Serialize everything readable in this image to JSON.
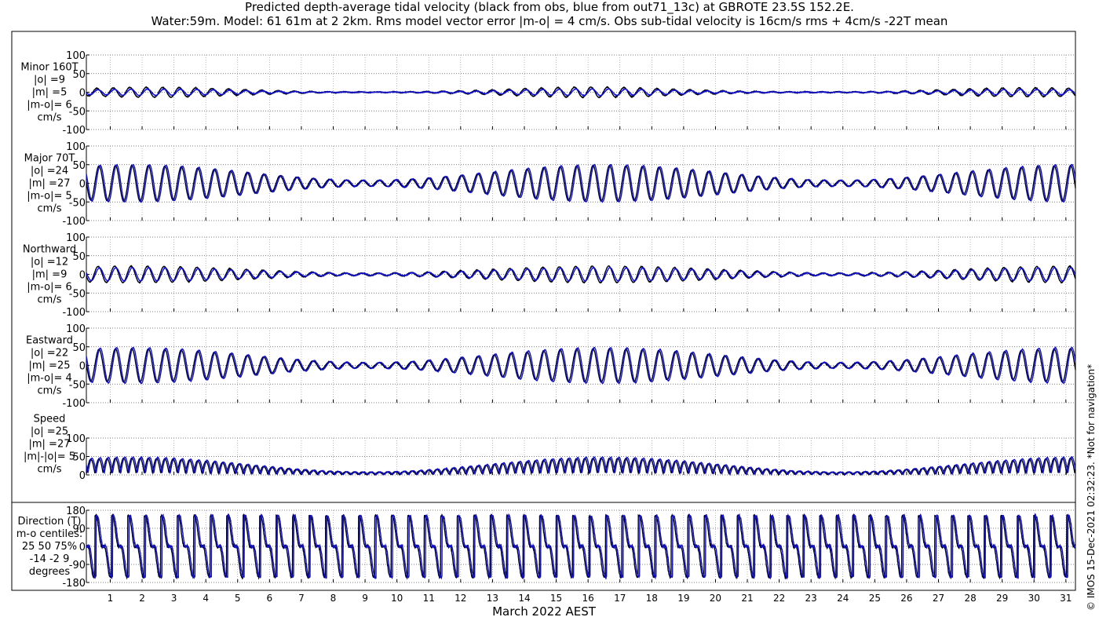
{
  "title": {
    "line1": "Predicted depth-average tidal velocity (black from obs, blue from out71_13c) at GBROTE 23.5S 152.2E.",
    "line2": "Water:59m. Model: 61 61m at 2 2km. Rms model vector error |m-o| = 4 cm/s. Obs sub-tidal velocity is 16cm/s rms + 4cm/s -22T mean"
  },
  "stamp": "© IMOS 15-Dec-2021 02:32:23. *Not for navigation*",
  "colors": {
    "obs": "#000000",
    "model": "#1111cc",
    "grid": "#555555"
  },
  "chart_data": {
    "type": "line",
    "xlabel": "March 2022 AEST",
    "x_ticks": [
      "1",
      "2",
      "3",
      "4",
      "5",
      "6",
      "7",
      "8",
      "9",
      "10",
      "11",
      "12",
      "13",
      "14",
      "15",
      "16",
      "17",
      "18",
      "19",
      "20",
      "21",
      "22",
      "23",
      "24",
      "25",
      "26",
      "27",
      "28",
      "29",
      "30",
      "31"
    ],
    "xlim": [
      0.25,
      31.3
    ],
    "grid": "dotted",
    "panels": [
      {
        "label": [
          "Minor 160T",
          "|o| =9",
          "|m| =5",
          "|m-o|= 6",
          "cm/s"
        ],
        "ylim": [
          -100,
          100
        ],
        "yticks": [
          "100",
          "50",
          "0",
          "-50",
          "-100"
        ],
        "series": [
          {
            "name": "obs",
            "amplitude": 14
          },
          {
            "name": "model",
            "amplitude": 9
          }
        ]
      },
      {
        "label": [
          "Major 70T",
          "|o| =24",
          "|m| =27",
          "|m-o|= 5",
          "cm/s"
        ],
        "ylim": [
          -100,
          100
        ],
        "yticks": [
          "100",
          "50",
          "0",
          "-50",
          "-100"
        ],
        "series": [
          {
            "name": "obs",
            "amplitude": 48
          },
          {
            "name": "model",
            "amplitude": 50
          }
        ]
      },
      {
        "label": [
          "Northward",
          "|o| =12",
          "|m| =9",
          "|m-o|= 6",
          "cm/s"
        ],
        "ylim": [
          -100,
          100
        ],
        "yticks": [
          "100",
          "50",
          "0",
          "-50",
          "-100"
        ],
        "series": [
          {
            "name": "obs",
            "amplitude": 22
          },
          {
            "name": "model",
            "amplitude": 18
          }
        ]
      },
      {
        "label": [
          "Eastward",
          "|o| =22",
          "|m| =25",
          "|m-o|= 4",
          "cm/s"
        ],
        "ylim": [
          -100,
          100
        ],
        "yticks": [
          "100",
          "50",
          "0",
          "-50",
          "-100"
        ],
        "series": [
          {
            "name": "obs",
            "amplitude": 45
          },
          {
            "name": "model",
            "amplitude": 48
          }
        ]
      },
      {
        "label": [
          "Speed",
          "|o| =25",
          "|m| =27",
          "|m|-|o|= 5",
          "cm/s"
        ],
        "ylim": [
          0,
          100
        ],
        "yticks": [
          "100",
          "50",
          "0"
        ],
        "series": [
          {
            "name": "obs",
            "amplitude": 45
          },
          {
            "name": "model",
            "amplitude": 48
          }
        ]
      },
      {
        "label": [
          "Direction (T)",
          "m-o centiles:",
          "25  50  75%",
          "-14  -2   9",
          "degrees"
        ],
        "ylim": [
          -180,
          180
        ],
        "yticks": [
          "180",
          "90",
          "0",
          "-90",
          "-180"
        ],
        "series": [
          {
            "name": "obs"
          },
          {
            "name": "model"
          }
        ]
      }
    ]
  }
}
